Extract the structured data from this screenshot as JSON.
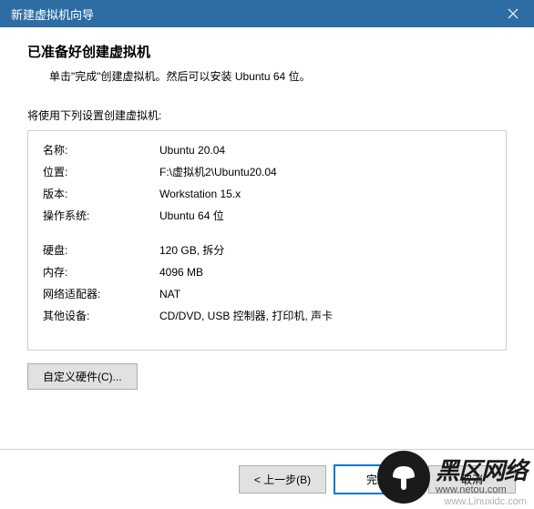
{
  "titlebar": {
    "title": "新建虚拟机向导"
  },
  "header": {
    "heading": "已准备好创建虚拟机",
    "subheading": "单击\"完成\"创建虚拟机。然后可以安装 Ubuntu 64 位。"
  },
  "section_label": "将使用下列设置创建虚拟机:",
  "summary": {
    "name_label": "名称:",
    "name_value": "Ubuntu 20.04",
    "location_label": "位置:",
    "location_value": "F:\\虚拟机2\\Ubuntu20.04",
    "version_label": "版本:",
    "version_value": "Workstation 15.x",
    "os_label": "操作系统:",
    "os_value": "Ubuntu 64 位",
    "disk_label": "硬盘:",
    "disk_value": "120 GB, 拆分",
    "memory_label": "内存:",
    "memory_value": "4096 MB",
    "network_label": "网络适配器:",
    "network_value": "NAT",
    "other_label": "其他设备:",
    "other_value": "CD/DVD, USB 控制器, 打印机, 声卡"
  },
  "buttons": {
    "customize": "自定义硬件(C)...",
    "back": "< 上一步(B)",
    "finish": "完成",
    "cancel": "取消"
  },
  "watermark": {
    "main": "黑区网络",
    "sub": "www.netou.com",
    "alt": "www.Linuxidc.com"
  }
}
